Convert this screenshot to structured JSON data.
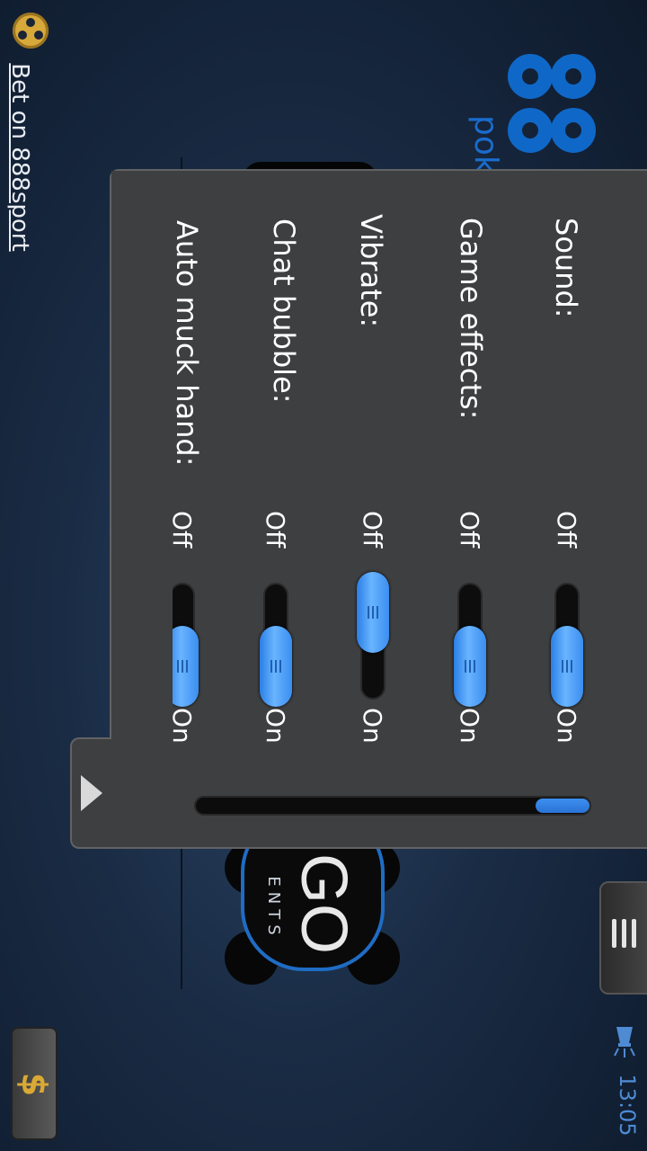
{
  "top_link": {
    "label": "Bet on 888sport"
  },
  "branding": {
    "logo_digits": "88",
    "logo_sub": "pok",
    "bingo_title": "GO",
    "bingo_sub": "ENTS"
  },
  "settings": {
    "items": [
      {
        "label": "Sound:",
        "off": "Off",
        "on": "On",
        "state": "on"
      },
      {
        "label": "Game effects:",
        "off": "Off",
        "on": "On",
        "state": "on"
      },
      {
        "label": "Vibrate:",
        "off": "Off",
        "on": "On",
        "state": "off"
      },
      {
        "label": "Chat bubble:",
        "off": "Off",
        "on": "On",
        "state": "on"
      },
      {
        "label": "Auto muck hand:",
        "off": "Off",
        "on": "On",
        "state": "on"
      }
    ],
    "scroll_position": 0.9
  },
  "status": {
    "time": "13:05"
  },
  "cashier": {
    "symbol": "$"
  },
  "colors": {
    "accent": "#2a7fe6",
    "panel": "#3e3f40",
    "brand": "#0f68c8",
    "gold": "#d9a935"
  }
}
